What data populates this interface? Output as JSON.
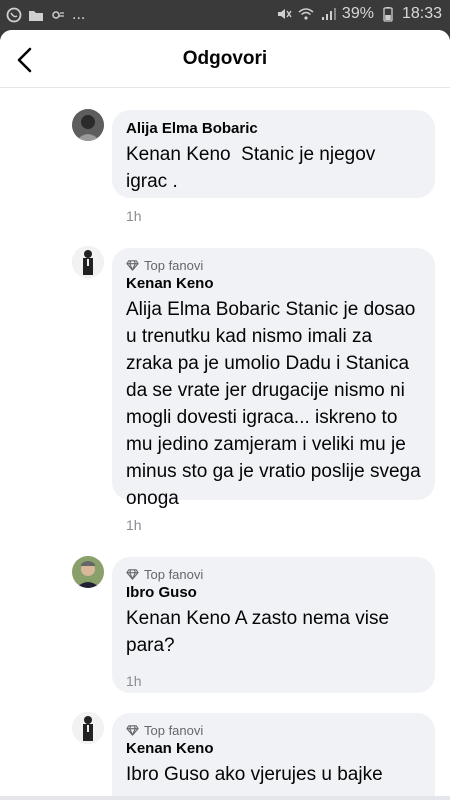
{
  "status_bar": {
    "dots": "...",
    "battery_text": "39%",
    "time": "18:33"
  },
  "header": {
    "title": "Odgovori"
  },
  "comments": [
    {
      "badge": "",
      "author": "Alija Elma Bobaric",
      "text": "Kenan Keno  Stanic je njegov igrac .",
      "time": "1h"
    },
    {
      "badge": "Top fanovi",
      "author": "Kenan Keno",
      "text": "Alija Elma Bobaric Stanic je dosao u trenutku kad nismo imali za zraka pa je umolio Dadu i Stanica da se vrate jer drugacije nismo ni mogli dovesti igraca... iskreno to mu jedino zamjeram i veliki mu je minus sto ga je vratio poslije svega onoga",
      "time": "1h"
    },
    {
      "badge": "Top fanovi",
      "author": "Ibro Guso",
      "text": "Kenan Keno A zasto nema vise para?",
      "time": "1h"
    },
    {
      "badge": "Top fanovi",
      "author": "Kenan Keno",
      "text": "Ibro Guso ako vjerujes u bajke",
      "time": ""
    }
  ],
  "colors": {
    "bubble": "#f0f2f5",
    "text": "#050505",
    "secondary": "#65676b"
  }
}
